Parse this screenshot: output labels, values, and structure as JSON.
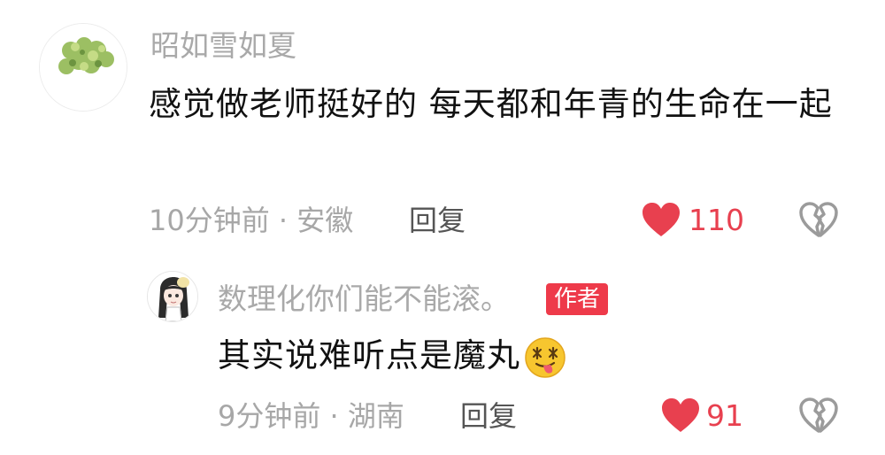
{
  "comment": {
    "username": "昭如雪如夏",
    "text": "感觉做老师挺好的 每天都和年青的生命在一起",
    "time_location": "10分钟前 · 安徽",
    "reply_label": "回复",
    "like_count": "110",
    "avatar_icon": "tree-leaves-avatar",
    "colors": {
      "like": "#e8404f",
      "meta": "#a7a7a7"
    }
  },
  "reply": {
    "username": "数理化你们能不能滚。",
    "badge": "作者",
    "text": "其实说难听点是魔丸",
    "emoji_icon": "dizzy-tongue-face-emoji",
    "time_location": "9分钟前 · 湖南",
    "reply_label": "回复",
    "like_count": "91",
    "avatar_icon": "anime-girl-avatar",
    "colors": {
      "badge": "#ee3a4a"
    }
  }
}
